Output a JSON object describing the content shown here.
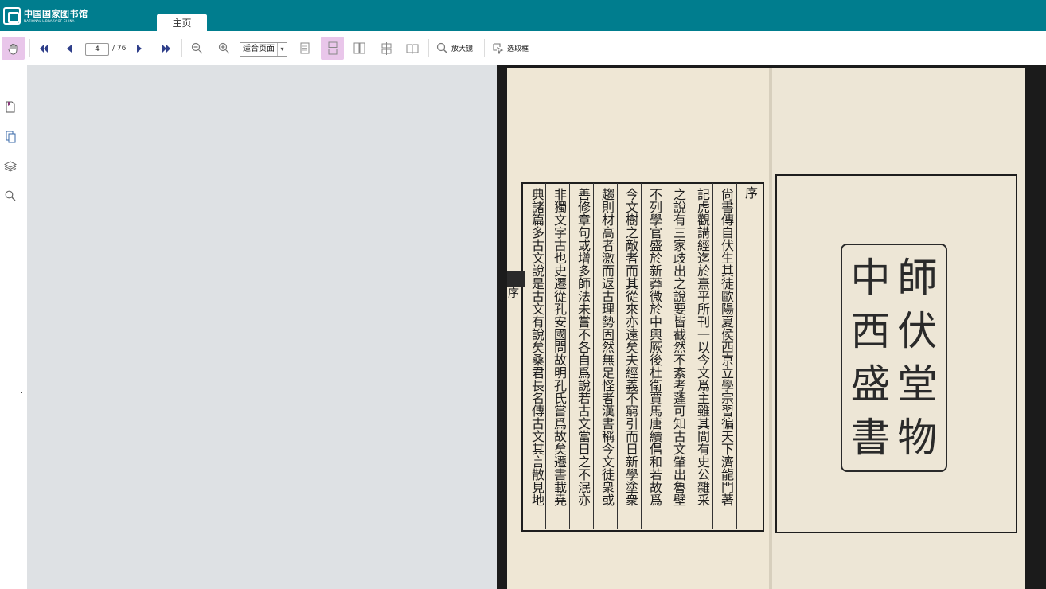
{
  "header": {
    "logo_cn": "中国国家图书馆",
    "logo_en": "NATIONAL LIBRARY OF CHINA",
    "tab_home": "主页"
  },
  "toolbar": {
    "current_page": "4",
    "total_pages": "/ 76",
    "zoom_mode": "适合页面",
    "magnifier_label": "放大镜",
    "select_box_label": "选取框",
    "icons": [
      "hand-tool-icon",
      "first-page-icon",
      "prev-page-icon",
      "next-page-icon",
      "last-page-icon",
      "zoom-out-icon",
      "zoom-in-icon",
      "single-page-icon",
      "continuous-page-icon",
      "two-page-icon",
      "two-page-continuous-icon",
      "book-view-icon",
      "magnifier-icon",
      "select-box-icon"
    ]
  },
  "sidebar": {
    "icons": [
      "bookmark-icon",
      "thumbnails-icon",
      "layers-icon",
      "search-icon"
    ]
  },
  "document": {
    "header_char": "序",
    "columns": [
      "尙書傳自伏生其徒歐陽夏侯西京立學宗習徧天下濟龍門著",
      "記虎觀講經迄於熹平所刊一以今文爲主雖其間有史公雜采",
      "之說有三家歧出之說要皆截然不紊考蓬可知古文肇出魯壁",
      "不列學官盛於新莽微於中興厥後杜衛賈馬唐續倡和若故爲",
      "今文樹之敵者而其從來亦遠矣夫經義不窮引而日新學塗衆",
      "趨則材高者激而返古理勢固然無足怪者漢書稱今文徒衆或",
      "善修章句或增多師法未嘗不各自爲說若古文當日之不泯亦",
      "非獨文字古也史遷從孔安國問故明孔氏嘗爲故矣遷書載堯",
      "典諸篇多古文說是古文有說矣桑君長名傳古文其言散見地"
    ],
    "seal_chars": [
      "中",
      "師",
      "西",
      "伏",
      "盛",
      "堂",
      "書",
      "物"
    ]
  }
}
